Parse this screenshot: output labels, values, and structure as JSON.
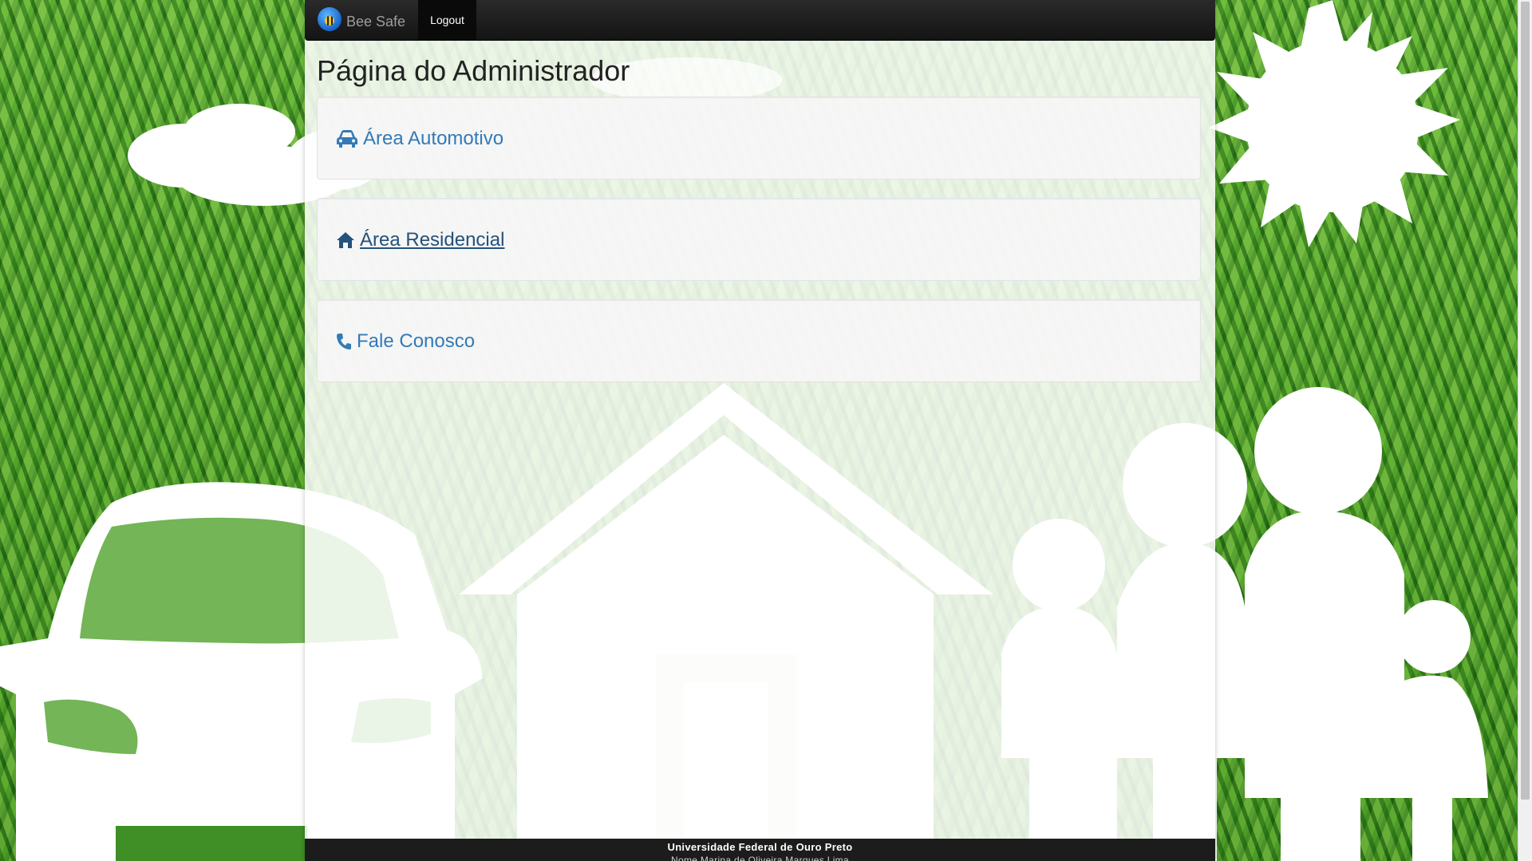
{
  "navbar": {
    "brand_name": "Bee Safe",
    "logout_label": "Logout"
  },
  "page": {
    "title": "Página do Administrador"
  },
  "panels": [
    {
      "label": "Área Automotivo",
      "icon": "car-icon"
    },
    {
      "label": "Área Residencial",
      "icon": "home-icon"
    },
    {
      "label": "Fale Conosco",
      "icon": "phone-icon"
    }
  ],
  "footer": {
    "university": "Universidade Federal de Ouro Preto",
    "names": "Nome Marina de Oliveira Marques Lima"
  },
  "colors": {
    "link": "#337ab7",
    "link_hover": "#23527c",
    "navbar": "#1c1c1c",
    "background_grass": "#3f8f26"
  }
}
